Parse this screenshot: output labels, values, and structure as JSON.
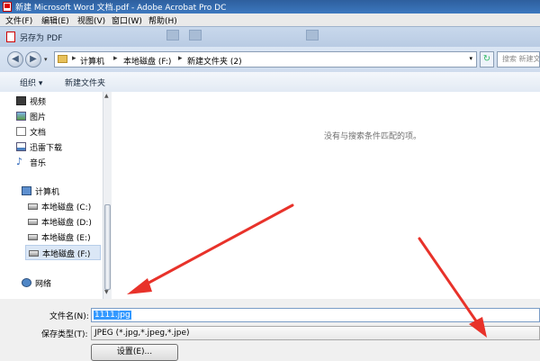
{
  "app": {
    "title": "新建 Microsoft Word 文档.pdf - Adobe Acrobat Pro DC",
    "menu": [
      "文件(F)",
      "编辑(E)",
      "视图(V)",
      "窗口(W)",
      "帮助(H)"
    ]
  },
  "dialog": {
    "title": "另存为 PDF",
    "breadcrumb": [
      "计算机",
      "本地磁盘 (F:)",
      "新建文件夹 (2)"
    ],
    "search_placeholder": "搜索 新建文件夹",
    "commands": {
      "organize": "组织 ▾",
      "new_folder": "新建文件夹"
    },
    "nav_items": [
      {
        "label": "视频",
        "icon": "video-icon"
      },
      {
        "label": "图片",
        "icon": "picture-icon"
      },
      {
        "label": "文档",
        "icon": "document-icon"
      },
      {
        "label": "迅雷下载",
        "icon": "download-icon"
      },
      {
        "label": "音乐",
        "icon": "music-icon"
      },
      {
        "label": "计算机",
        "icon": "computer-icon"
      },
      {
        "label": "本地磁盘 (C:)",
        "icon": "drive-icon"
      },
      {
        "label": "本地磁盘 (D:)",
        "icon": "drive-icon"
      },
      {
        "label": "本地磁盘 (E:)",
        "icon": "drive-icon"
      },
      {
        "label": "本地磁盘 (F:)",
        "icon": "drive-icon",
        "selected": true
      },
      {
        "label": "网络",
        "icon": "network-icon"
      }
    ],
    "empty_message": "没有与搜索条件匹配的项。",
    "filename_label": "文件名(N):",
    "filename_value": "1111.jpg",
    "filetype_label": "保存类型(T):",
    "filetype_value": "JPEG (*.jpg,*.jpeg,*.jpe)",
    "settings_button": "设置(E)..."
  },
  "colors": {
    "selection": "#3399ff",
    "annotation": "#e8322a",
    "title_bar": "#3c78bf"
  }
}
